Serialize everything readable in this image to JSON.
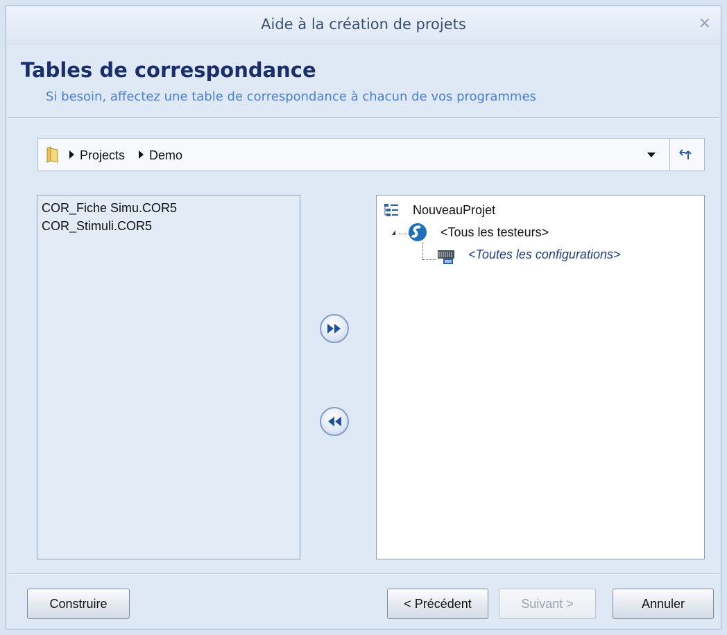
{
  "window": {
    "title": "Aide à la création de projets",
    "close_symbol": "×"
  },
  "header": {
    "heading": "Tables de correspondance",
    "subheading": "Si besoin, affectez une table de correspondance à chacun de vos programmes"
  },
  "pathbar": {
    "icon": "folder-icon",
    "crumbs": [
      "Projects",
      "Demo"
    ],
    "refresh_icon": "refresh-icon"
  },
  "left_list": {
    "items": [
      "COR_Fiche Simu.COR5",
      "COR_Stimuli.COR5"
    ]
  },
  "tree": {
    "root": "NouveauProjet",
    "child": "<Tous les testeurs>",
    "grandchild": "<Toutes les configurations>"
  },
  "buttons": {
    "build": "Construire",
    "previous": "< Précédent",
    "next": "Suivant >",
    "cancel": "Annuler"
  },
  "colors": {
    "heading": "#1a2f6a",
    "subheading": "#4a7fd0",
    "background": "#dfe9f6"
  }
}
